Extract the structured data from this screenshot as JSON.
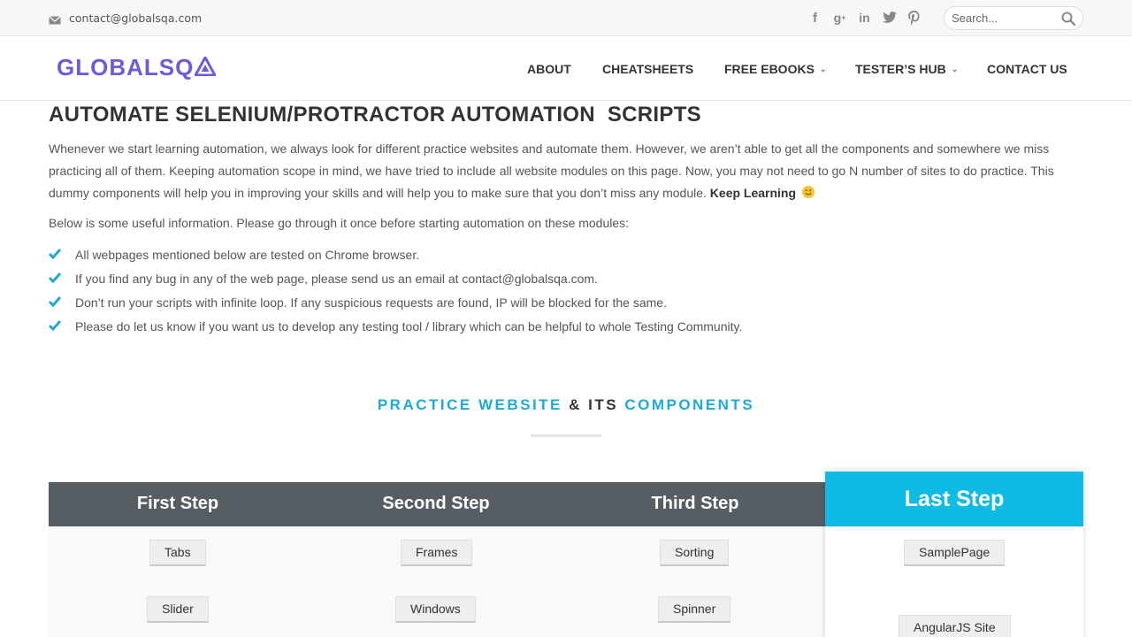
{
  "topbar": {
    "email": "contact@globalsqa.com",
    "social_icons": [
      "facebook-icon",
      "google-plus-icon",
      "linkedin-icon",
      "twitter-icon",
      "pinterest-icon"
    ],
    "search_placeholder": "Search..."
  },
  "header": {
    "logo_text": "GLOBALSQ",
    "nav": [
      {
        "label": "ABOUT",
        "has_dropdown": false
      },
      {
        "label": "CHEATSHEETS",
        "has_dropdown": false
      },
      {
        "label": "FREE EBOOKS",
        "has_dropdown": true
      },
      {
        "label": "TESTER’S HUB",
        "has_dropdown": true
      },
      {
        "label": "CONTACT US",
        "has_dropdown": false
      }
    ]
  },
  "main": {
    "title": "AUTOMATE SELENIUM/PROTRACTOR AUTOMATION  SCRIPTS",
    "intro": "Whenever we start learning automation, we always look for different practice websites and automate them. However, we aren’t able to get all the components and somewhere we miss practicing all of them. Keeping automation scope in mind, we have tried to include all website modules on this page. Now, you may not need to go N number of sites to do practice. This dummy components will help you in improving your skills and will help you to make sure that you don’t miss any module.",
    "intro_bold": "Keep Learning",
    "info": "Below is some useful information. Please go through it once before starting automation on these modules:",
    "checklist": [
      "All webpages mentioned below are tested on Chrome browser.",
      "If you find any bug in any of the web page, please send us an email at contact@globalsqa.com.",
      "Don’t run your scripts with infinite loop. If any suspicious requests are found, IP will be blocked for the same.",
      "Please do let us know if you want us to develop any testing tool / library which can be helpful to whole Testing Community."
    ],
    "section_title": {
      "part1": "PRACTICE WEBSITE",
      "part2": "& ITS",
      "part3": "COMPONENTS"
    },
    "steps": [
      {
        "title": "First Step",
        "buttons": [
          "Tabs",
          "Slider"
        ]
      },
      {
        "title": "Second Step",
        "buttons": [
          "Frames",
          "Windows"
        ]
      },
      {
        "title": "Third Step",
        "buttons": [
          "Sorting",
          "Spinner"
        ]
      },
      {
        "title": "Last Step",
        "buttons": [
          "SamplePage",
          "AngularJS Site"
        ]
      }
    ]
  },
  "colors": {
    "accent": "#1eaad8",
    "last_step_header": "#0fbbe3",
    "steps_header": "#565e64",
    "logo": "#6f5ad9",
    "check": "#1eaad8"
  }
}
